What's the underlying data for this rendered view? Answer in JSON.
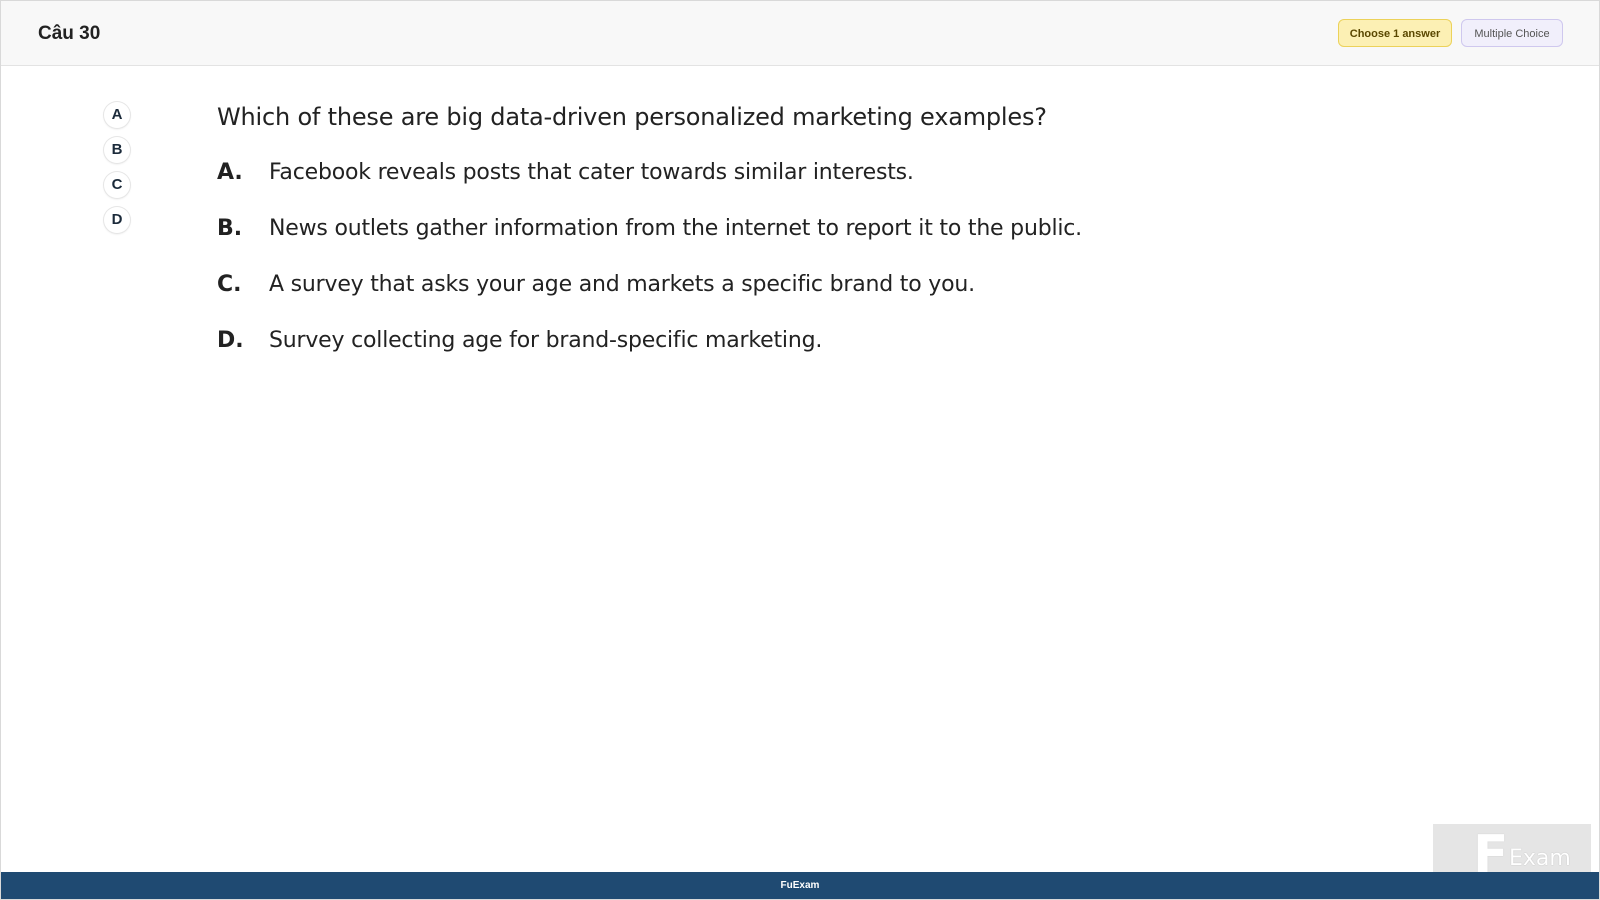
{
  "header": {
    "question_title": "Câu 30",
    "choose_badge": "Choose 1 answer",
    "type_badge": "Multiple Choice"
  },
  "nav": {
    "items": [
      "A",
      "B",
      "C",
      "D"
    ]
  },
  "question": {
    "text": "Which of these are big data-driven personalized marketing examples?",
    "options": [
      {
        "letter": "A.",
        "text": "Facebook reveals posts that cater towards similar interests."
      },
      {
        "letter": "B.",
        "text": "News outlets gather information from the internet to report it to the public."
      },
      {
        "letter": "C.",
        "text": "A survey that asks your age and markets a specific brand to you."
      },
      {
        "letter": "D.",
        "text": "Survey collecting age for brand-specific marketing."
      }
    ]
  },
  "footer": {
    "label": "FuExam"
  },
  "watermark": {
    "letter": "F",
    "text": "Exam"
  },
  "colors": {
    "footer_bg": "#1f4a72",
    "choose_badge_bg": "#fcf0b4",
    "type_badge_bg": "#f1effb"
  }
}
